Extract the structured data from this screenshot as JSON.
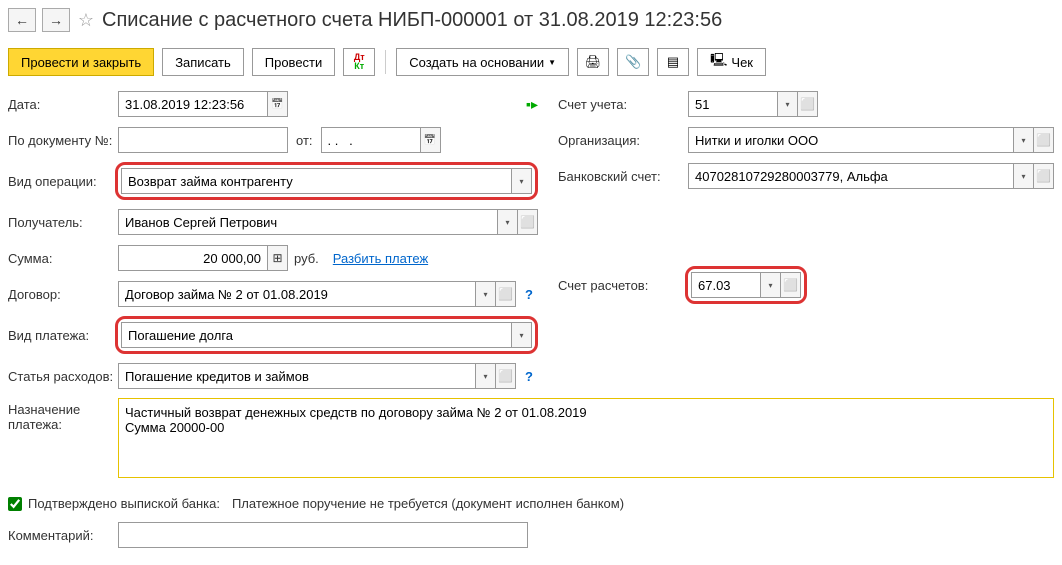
{
  "header": {
    "title": "Списание с расчетного счета НИБП-000001 от 31.08.2019 12:23:56"
  },
  "toolbar": {
    "post_close": "Провести и закрыть",
    "write": "Записать",
    "post": "Провести",
    "create_based": "Создать на основании",
    "check": "Чек"
  },
  "left": {
    "date_label": "Дата:",
    "date_value": "31.08.2019 12:23:56",
    "doc_num_label": "По документу №:",
    "doc_num_value": "",
    "from_label": "от:",
    "from_value": ". .   .",
    "op_type_label": "Вид операции:",
    "op_type_value": "Возврат займа контрагенту",
    "recipient_label": "Получатель:",
    "recipient_value": "Иванов Сергей Петрович",
    "amount_label": "Сумма:",
    "amount_value": "20 000,00",
    "currency": "руб.",
    "split_payment": "Разбить платеж",
    "contract_label": "Договор:",
    "contract_value": "Договор займа № 2 от 01.08.2019",
    "payment_type_label": "Вид платежа:",
    "payment_type_value": "Погашение долга",
    "expense_label": "Статья расходов:",
    "expense_value": "Погашение кредитов и займов"
  },
  "right": {
    "account_label": "Счет учета:",
    "account_value": "51",
    "org_label": "Организация:",
    "org_value": "Нитки и иголки ООО",
    "bank_acc_label": "Банковский счет:",
    "bank_acc_value": "40702810729280003779, Альфа",
    "settle_acc_label": "Счет расчетов:",
    "settle_acc_value": "67.03"
  },
  "purpose": {
    "label": "Назначение платежа:",
    "value": "Частичный возврат денежных средств по договору займа № 2 от 01.08.2019\nСумма 20000-00"
  },
  "confirm": {
    "checkbox_label": "Подтверждено выпиской банка:",
    "note": "Платежное поручение не требуется (документ исполнен банком)"
  },
  "comment": {
    "label": "Комментарий:",
    "value": ""
  }
}
